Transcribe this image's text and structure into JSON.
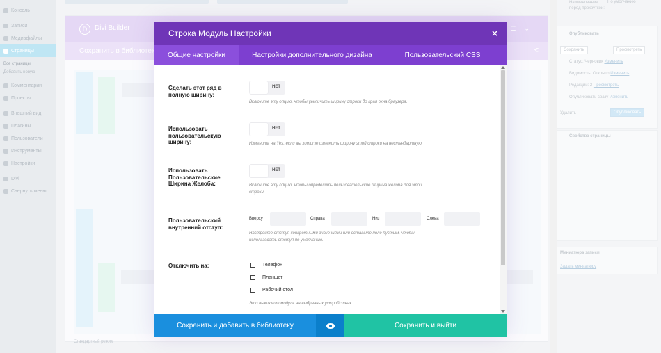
{
  "wp": {
    "menu": [
      {
        "label": "Консоль"
      },
      {
        "label": "Записи"
      },
      {
        "label": "Медиафайлы"
      },
      {
        "label": "Страницы",
        "active": true
      },
      {
        "label": "Комментарии"
      },
      {
        "label": "Проекты"
      },
      {
        "label": "Внешний вид"
      },
      {
        "label": "Плагины"
      },
      {
        "label": "Пользователи"
      },
      {
        "label": "Инструменты"
      },
      {
        "label": "Настройки"
      },
      {
        "label": "Divi"
      },
      {
        "label": "Свернуть меню"
      }
    ],
    "submenu": [
      "Все страницы",
      "Добавить новую"
    ],
    "builder_title": "Divi Builder",
    "builder_save_label": "Сохранить в библиотеку",
    "builder_footer": "Стандартный режим",
    "right": {
      "top_label": "Наименование перед прокруткой:",
      "top_value": "По умолчанию",
      "publish_title": "Опубликовать",
      "save_btn": "Сохранить",
      "preview_btn": "Просмотреть",
      "status": "Статус: Черновик",
      "status_link": "Изменить",
      "visibility": "Видимость: Открыто",
      "visibility_link": "Изменить",
      "revisions": "Редакции: 2",
      "revisions_link": "Просмотреть",
      "publish_when": "Опубликовать сразу",
      "publish_when_link": "Изменить",
      "delete": "Удалить",
      "publish_btn": "Опубликовать",
      "attributes_title": "Свойства страницы",
      "template_title": "Миниатюра записи",
      "template_link": "Задать миниатюру"
    }
  },
  "modal": {
    "title": "Строка Модуль Настройки",
    "close_icon": "×",
    "tabs": [
      {
        "label": "Общие настройки",
        "active": true
      },
      {
        "label": "Настройки дополнительного дизайна"
      },
      {
        "label": "Пользовательский CSS"
      }
    ],
    "fields": {
      "fullwidth": {
        "label": "Сделать этот ряд в полную ширину:",
        "toggle": "НЕТ",
        "desc": "Включите эту опцию, чтобы увеличить ширину строки до края окна браузера."
      },
      "custom_width": {
        "label": "Использовать пользовательскую ширину:",
        "toggle": "НЕТ",
        "desc": "Изменить на Yes, если вы хотите изменить ширину этой строки на нестандартную."
      },
      "gutter": {
        "label": "Использовать Пользовательские Ширина Желоба:",
        "toggle": "НЕТ",
        "desc": "Включите эту опцию, чтобы определить пользовательские Ширина желоба для этой строки."
      },
      "padding": {
        "label": "Пользовательский внутренний отступ:",
        "top": "Вверху",
        "right": "Справа",
        "bottom": "Низ",
        "left": "Слева",
        "desc": "Настройте отступ конкретными значениями или оставьте поле пустым, чтобы использовать отступ по умолчанию."
      },
      "disable_on": {
        "label": "Отключить на:",
        "options": [
          "Телефон",
          "Планшет",
          "Рабочий стол"
        ],
        "desc": "Это выключит модуль на выбранных устройствах"
      }
    },
    "footer": {
      "save_library": "Сохранить и добавить в библиотеку",
      "preview_icon": "eye-icon",
      "save_exit": "Сохранить и выйти"
    }
  },
  "colors": {
    "header": "#6f35b7",
    "tabs": "#7d3fd0",
    "tab_active": "#8b4fdc",
    "save_library": "#1a8fde",
    "preview": "#0b7fcb",
    "save_exit": "#20c3a4"
  }
}
